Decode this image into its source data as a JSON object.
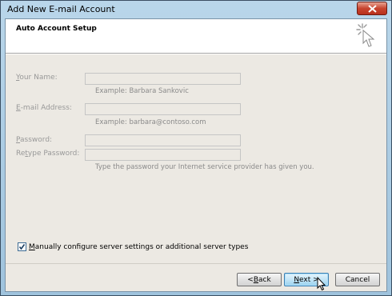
{
  "window": {
    "title": "Add New E-mail Account"
  },
  "header": {
    "title": "Auto Account Setup"
  },
  "form": {
    "name_label_ul": "Y",
    "name_label_rest": "our Name:",
    "name_value": "",
    "name_hint": "Example: Barbara Sankovic",
    "email_label_ul": "E",
    "email_label_rest": "-mail Address:",
    "email_value": "",
    "email_hint": "Example: barbara@contoso.com",
    "password_label_ul": "P",
    "password_label_rest": "assword:",
    "password_value": "",
    "retype_label_pre": "Re",
    "retype_label_ul": "t",
    "retype_label_rest": "ype Password:",
    "retype_value": "",
    "password_hint": "Type the password your Internet service provider has given you."
  },
  "manual_config": {
    "checked": true,
    "label_ul": "M",
    "label_rest": "anually configure server settings or additional server types"
  },
  "buttons": {
    "back_pre": "< ",
    "back_ul": "B",
    "back_rest": "ack",
    "next_ul": "N",
    "next_rest": "ext >",
    "cancel": "Cancel"
  },
  "icons": {
    "close": "close-icon",
    "header": "mouse-cursor-icon",
    "pointer": "mouse-pointer-icon"
  }
}
